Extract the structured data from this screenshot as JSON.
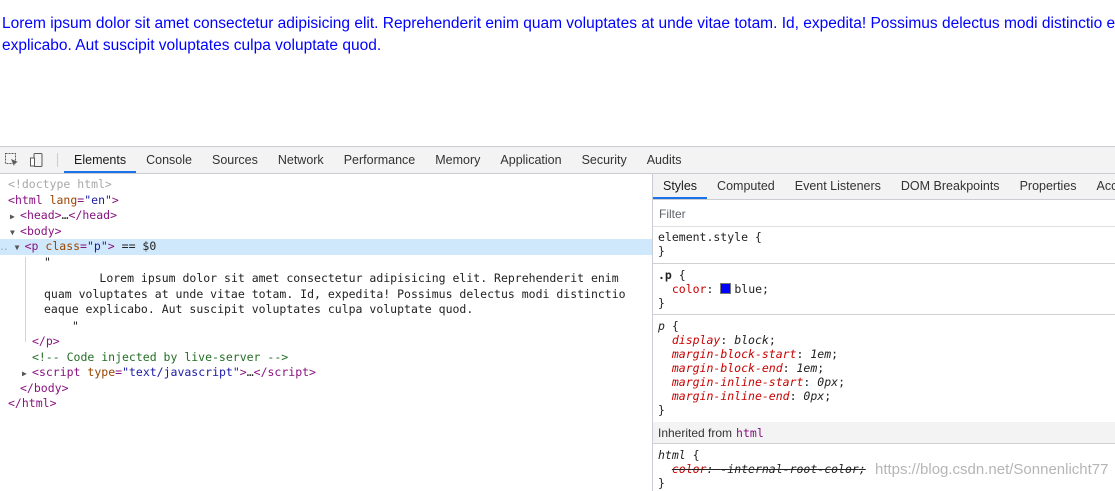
{
  "page": {
    "paragraph_text": "Lorem ipsum dolor sit amet consectetur adipisicing elit. Reprehenderit enim quam voluptates at unde vitae totam. Id, expedita! Possimus delectus modi distinctio eaque explicabo. Aut suscipit voluptates culpa voluptate quod.",
    "paragraph_color": "#0000ff"
  },
  "toolbar": {
    "inspect_icon": "inspect-element-icon",
    "device_icon": "device-toolbar-icon",
    "tabs": [
      "Elements",
      "Console",
      "Sources",
      "Network",
      "Performance",
      "Memory",
      "Application",
      "Security",
      "Audits"
    ],
    "active_tab": "Elements"
  },
  "dom": {
    "doctype": "<!doctype html>",
    "html_open_tag": "html",
    "html_attr": "lang",
    "html_attr_val": "\"en\"",
    "head_tag": "head",
    "head_collapsed": "…",
    "body_tag": "body",
    "p_tag": "p",
    "p_attr": "class",
    "p_attr_val": "\"p\"",
    "selected_marker": "== $0",
    "quote": "\"",
    "text_content": "        Lorem ipsum dolor sit amet consectetur adipisicing elit. Reprehenderit enim quam voluptates at unde vitae totam. Id, expedita! Possimus delectus modi distinctio eaque explicabo. Aut suscipit voluptates culpa voluptate quod.\n    ",
    "comment": "<!-- Code injected by live-server -->",
    "script_tag": "script",
    "script_attr": "type",
    "script_attr_val": "\"text/javascript\"",
    "script_collapsed": "…"
  },
  "styles": {
    "tabs": [
      "Styles",
      "Computed",
      "Event Listeners",
      "DOM Breakpoints",
      "Properties",
      "Accessibility"
    ],
    "active_tab": "Styles",
    "filter_placeholder": "Filter",
    "element_style": "element.style {",
    "close_brace": "}",
    "rule_p_selector": ".p",
    "rule_p_color_prop": "color",
    "rule_p_color_value": "blue",
    "ua_selector": "p",
    "ua_props": [
      {
        "name": "display",
        "value": "block"
      },
      {
        "name": "margin-block-start",
        "value": "1em"
      },
      {
        "name": "margin-block-end",
        "value": "1em"
      },
      {
        "name": "margin-inline-start",
        "value": "0px"
      },
      {
        "name": "margin-inline-end",
        "value": "0px"
      }
    ],
    "inherited_label": "Inherited from",
    "inherited_tag": "html",
    "html_selector": "html",
    "html_prop": "color",
    "html_value": "-internal-root-color"
  },
  "watermark": "https://blog.csdn.net/Sonnenlicht77"
}
